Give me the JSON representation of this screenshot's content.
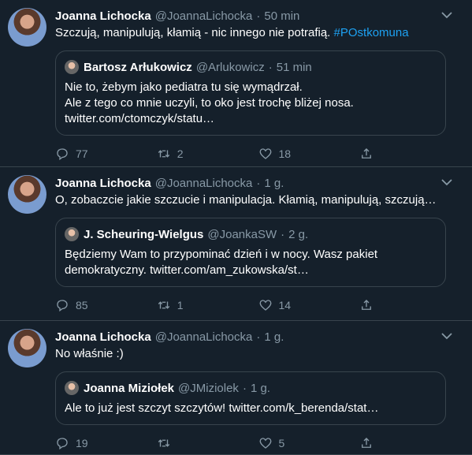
{
  "tweets": [
    {
      "author": "Joanna Lichocka",
      "handle": "@JoannaLichocka",
      "sep": "·",
      "time": "50 min",
      "text_plain": "Szczują, manipulują, kłamią - nic innego nie potrafią. ",
      "hashtag": "#POstkomuna",
      "quote": {
        "author": "Bartosz Arłukowicz",
        "handle": "@Arlukowicz",
        "sep": "·",
        "time": "51 min",
        "line1": "Nie to, żebym jako pediatra tu się wymądrzał.",
        "line2": "Ale z tego co mnie uczyli, to oko jest trochę bliżej nosa.",
        "line3": "twitter.com/ctomczyk/statu…"
      },
      "replies": "77",
      "retweets": "2",
      "likes": "18"
    },
    {
      "author": "Joanna Lichocka",
      "handle": "@JoannaLichocka",
      "sep": "·",
      "time": "1 g.",
      "text_plain": "O, zobaczcie jakie szczucie i manipulacja. Kłamią, manipulują, szczują…",
      "quote": {
        "author": "J. Scheuring-Wielgus",
        "handle": "@JoankaSW",
        "sep": "·",
        "time": "2 g.",
        "line1": "Będziemy Wam to przypominać dzień i w nocy. Wasz pakiet",
        "line2": "demokratyczny. twitter.com/am_zukowska/st…"
      },
      "replies": "85",
      "retweets": "1",
      "likes": "14"
    },
    {
      "author": "Joanna Lichocka",
      "handle": "@JoannaLichocka",
      "sep": "·",
      "time": "1 g.",
      "text_plain": "No właśnie :)",
      "quote": {
        "author": "Joanna Miziołek",
        "handle": "@JMiziolek",
        "sep": "·",
        "time": "1 g.",
        "line1": "Ale to już jest szczyt szczytów! twitter.com/k_berenda/stat…"
      },
      "replies": "19",
      "retweets": "",
      "likes": "5"
    }
  ],
  "icons": {
    "reply": "reply-icon",
    "retweet": "retweet-icon",
    "like": "heart-icon",
    "share": "share-icon",
    "caret": "chevron-down-icon"
  },
  "colors": {
    "background": "#15202b",
    "secondary_text": "#8899a6",
    "accent": "#1da1f2",
    "border": "#38444d"
  }
}
